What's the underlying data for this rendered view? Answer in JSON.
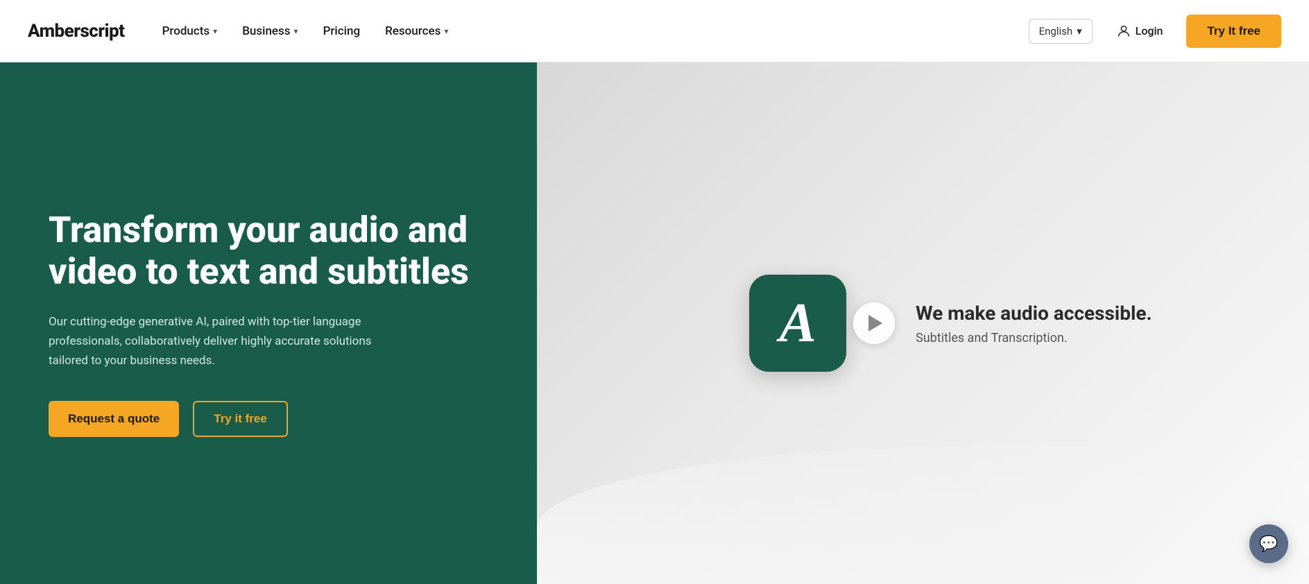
{
  "navbar": {
    "logo": "Amberscript",
    "nav_items": [
      {
        "label": "Products",
        "has_dropdown": true
      },
      {
        "label": "Business",
        "has_dropdown": true
      },
      {
        "label": "Pricing",
        "has_dropdown": false
      },
      {
        "label": "Resources",
        "has_dropdown": true
      }
    ],
    "language": {
      "label": "English",
      "has_dropdown": true
    },
    "login_label": "Login",
    "try_free_label": "Try It free"
  },
  "hero": {
    "title": "Transform your audio and video to text and subtitles",
    "description": "Our cutting-edge generative AI, paired with top-tier language professionals, collaboratively deliver highly accurate solutions tailored to your business needs.",
    "btn_quote": "Request a quote",
    "btn_try_free": "Try it free"
  },
  "video_preview": {
    "title": "We make audio accessible.",
    "subtitle": "Subtitles and Transcription."
  },
  "chat": {
    "icon": "💬"
  }
}
